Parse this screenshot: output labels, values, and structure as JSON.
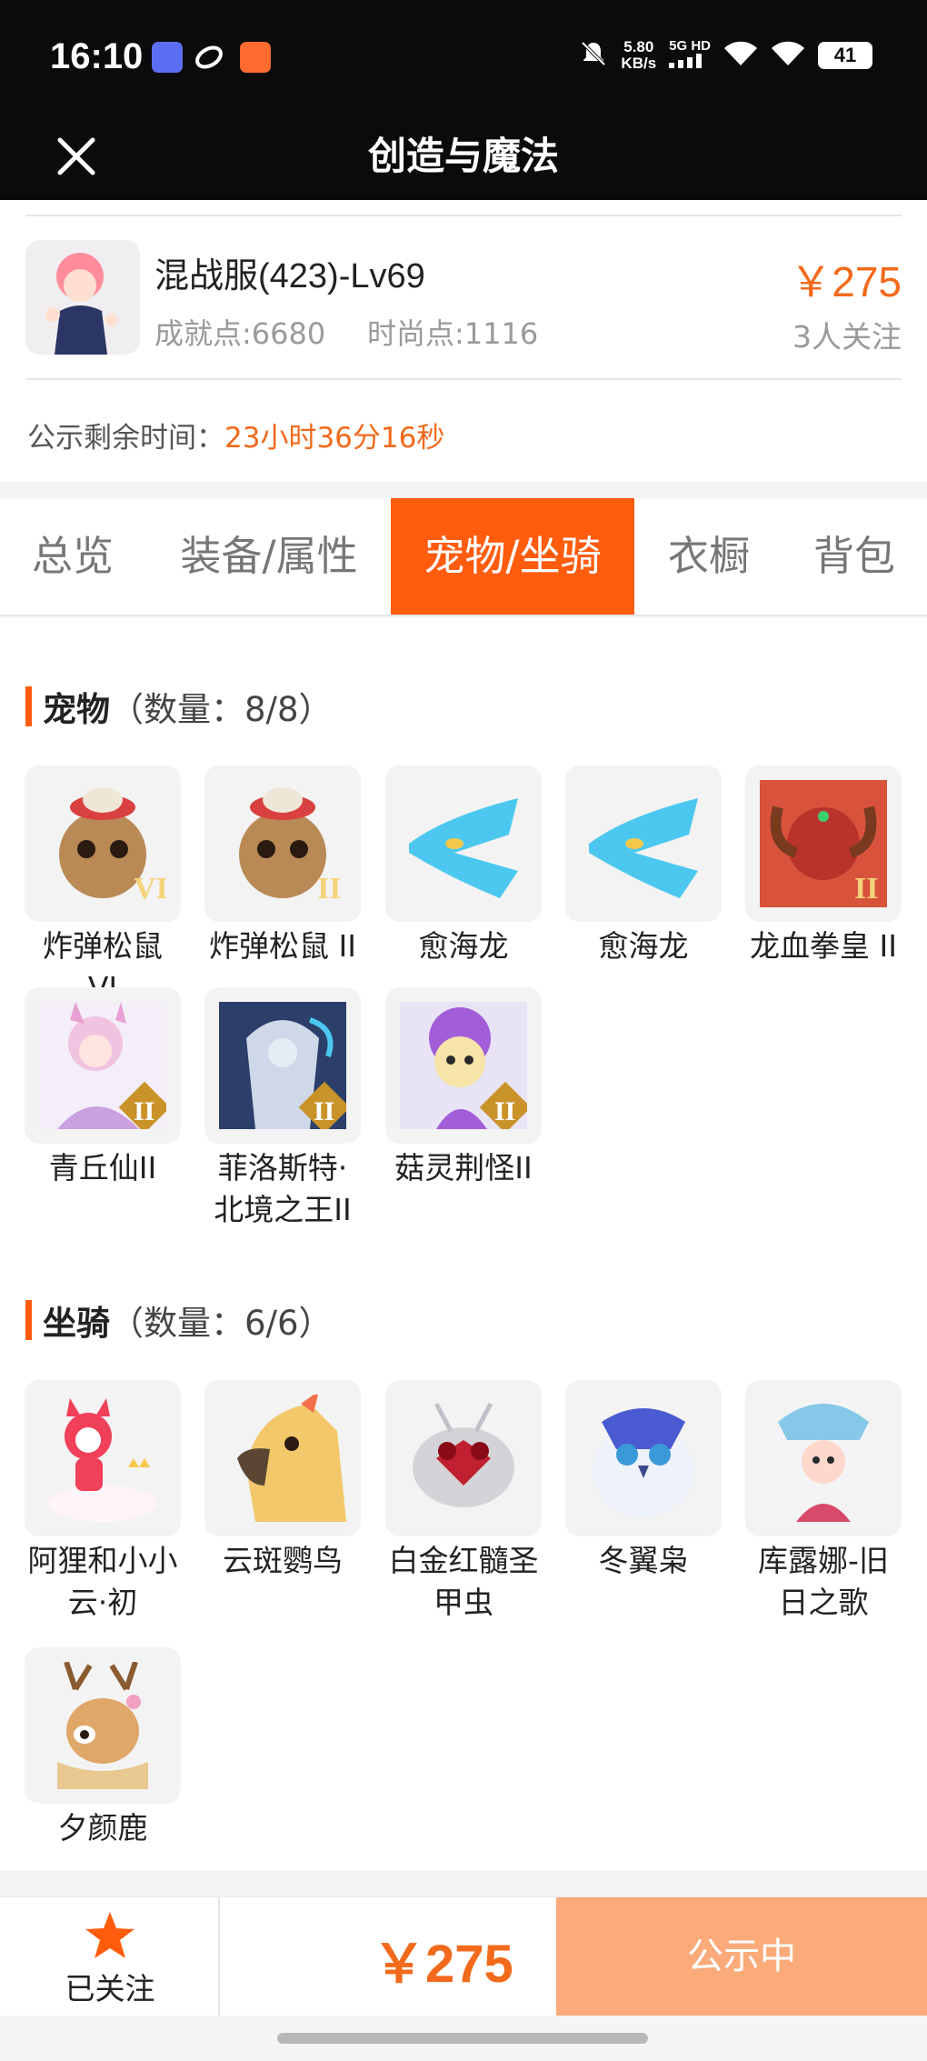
{
  "status_bar": {
    "time": "16:10",
    "speed_value": "5.80",
    "speed_unit": "KB/s",
    "network": "5G HD",
    "battery": "41",
    "icons": [
      "tieba-app-icon",
      "browser-app-icon",
      "video-app-icon",
      "mute-icon",
      "signal-icon",
      "wifi-icon",
      "wifi-icon",
      "battery-icon"
    ]
  },
  "nav": {
    "title": "创造与魔法",
    "close_icon": "close-icon"
  },
  "listing": {
    "server": "混战服(423)-Lv69",
    "achievement": "成就点:6680",
    "fashion": "时尚点:1116",
    "price": "￥275",
    "followers": "3人关注",
    "timer_label": "公示剩余时间：",
    "timer_value": "23小时36分16秒"
  },
  "tabs": [
    {
      "label": "总览",
      "active": false
    },
    {
      "label": "装备/属性",
      "active": false
    },
    {
      "label": "宠物/坐骑",
      "active": true
    },
    {
      "label": "衣橱",
      "active": false
    },
    {
      "label": "背包",
      "active": false
    }
  ],
  "pets": {
    "title": "宠物",
    "count": "（数量：8/8）",
    "items": [
      {
        "name": "炸弹松鼠 VI",
        "badge": "VI"
      },
      {
        "name": "炸弹松鼠 II",
        "badge": "II"
      },
      {
        "name": "愈海龙"
      },
      {
        "name": "愈海龙"
      },
      {
        "name": "龙血拳皇 II",
        "badge": "II"
      },
      {
        "name": "青丘仙II",
        "badge": "II"
      },
      {
        "name": "菲洛斯特·北境之王II",
        "badge": "II"
      },
      {
        "name": "菇灵荆怪II",
        "badge": "II"
      }
    ]
  },
  "mounts": {
    "title": "坐骑",
    "count": "（数量：6/6）",
    "items": [
      {
        "name": "阿狸和小小云·初"
      },
      {
        "name": "云斑鹦鸟"
      },
      {
        "name": "白金红髓圣甲虫"
      },
      {
        "name": "冬翼枭"
      },
      {
        "name": "库露娜-旧日之歌"
      },
      {
        "name": "夕颜鹿"
      }
    ]
  },
  "bottom": {
    "follow_label": "已关注",
    "price": "￥275",
    "status_button": "公示中"
  },
  "colors": {
    "accent": "#ff5c0e",
    "price": "#f26a1b",
    "status_button": "#fbaa7a"
  }
}
